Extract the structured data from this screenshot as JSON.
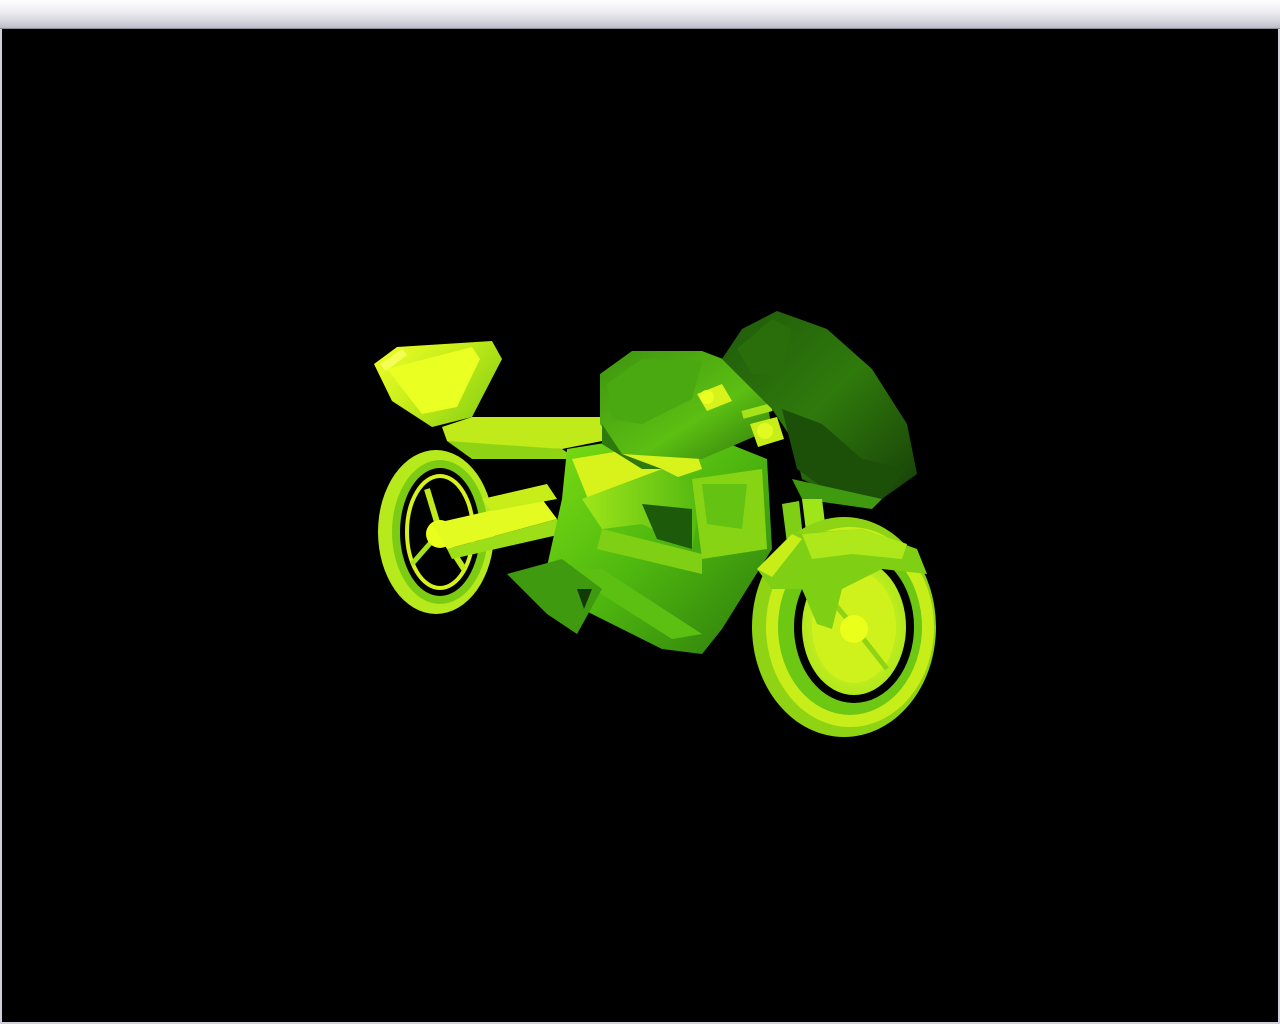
{
  "window": {
    "title": ""
  },
  "scene": {
    "background_color": "#000000",
    "model_name": "motorcycle-3d-model",
    "palette": {
      "bright": "#eaff1a",
      "yellow": "#d8f21c",
      "lime": "#8fdc14",
      "green": "#4fb80f",
      "mid_green": "#2f7a0c",
      "dark_green": "#173f08"
    }
  }
}
